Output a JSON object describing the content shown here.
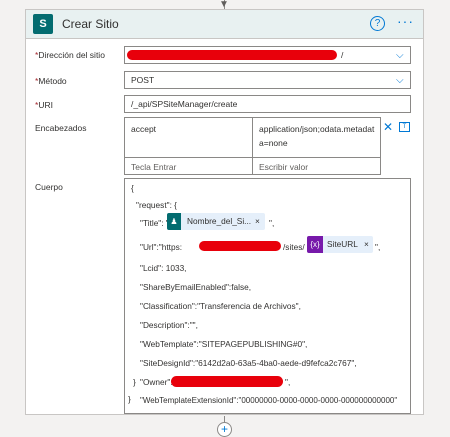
{
  "card": {
    "title": "Crear Sitio",
    "logo_text": "S",
    "help_glyph": "?",
    "more_glyph": "···"
  },
  "fields": {
    "site_label": "Dirección del sitio",
    "site_suffix": "/",
    "method_label": "Método",
    "method_value": "POST",
    "uri_label": "URI",
    "uri_value": "/_api/SPSiteManager/create",
    "headers_label": "Encabezados",
    "body_label": "Cuerpo",
    "required_mark": "*"
  },
  "headers": {
    "key": "accept",
    "value_line1": "application/json;odata.metadat",
    "value_line2": "a=none",
    "key_placeholder": "Tecla Entrar",
    "value_placeholder": "Escribir valor"
  },
  "body_lines": {
    "l1": "{",
    "l2": "\"request\": {",
    "l3a": "\"Title\": \"",
    "l3b": "\",",
    "l4a": "\"Url\":\"https:",
    "l4b": "/sites/",
    "l4c": "\",",
    "l5": "\"Lcid\": 1033,",
    "l6": "\"ShareByEmailEnabled\":false,",
    "l7": "\"Classification\":\"Transferencia de Archivos\",",
    "l8": "\"Description\":\"\",",
    "l9": "\"WebTemplate\":\"SITEPAGEPUBLISHING#0\",",
    "l10": "\"SiteDesignId\":\"6142d2a0-63a5-4ba0-aede-d9fefca2c767\",",
    "l11a": "\"Owner\":\"",
    "l11b": "\",",
    "l12": "\"WebTemplateExtensionId\":\"00000000-0000-0000-0000-000000000000\"",
    "l13": "}",
    "l14": "}"
  },
  "tokens": {
    "title_token": "Nombre_del_Si...",
    "title_close": "×",
    "url_token": "SiteURL",
    "url_close": "×",
    "expr_badge": "{x}"
  },
  "controls": {
    "chevron": "⌵",
    "delete_row": "✕",
    "add_step": "+",
    "arrow": "▼"
  },
  "colors": {
    "accent": "#0078d4",
    "sharepoint": "#036c70",
    "expression": "#7719aa",
    "redaction": "#e8000b"
  }
}
